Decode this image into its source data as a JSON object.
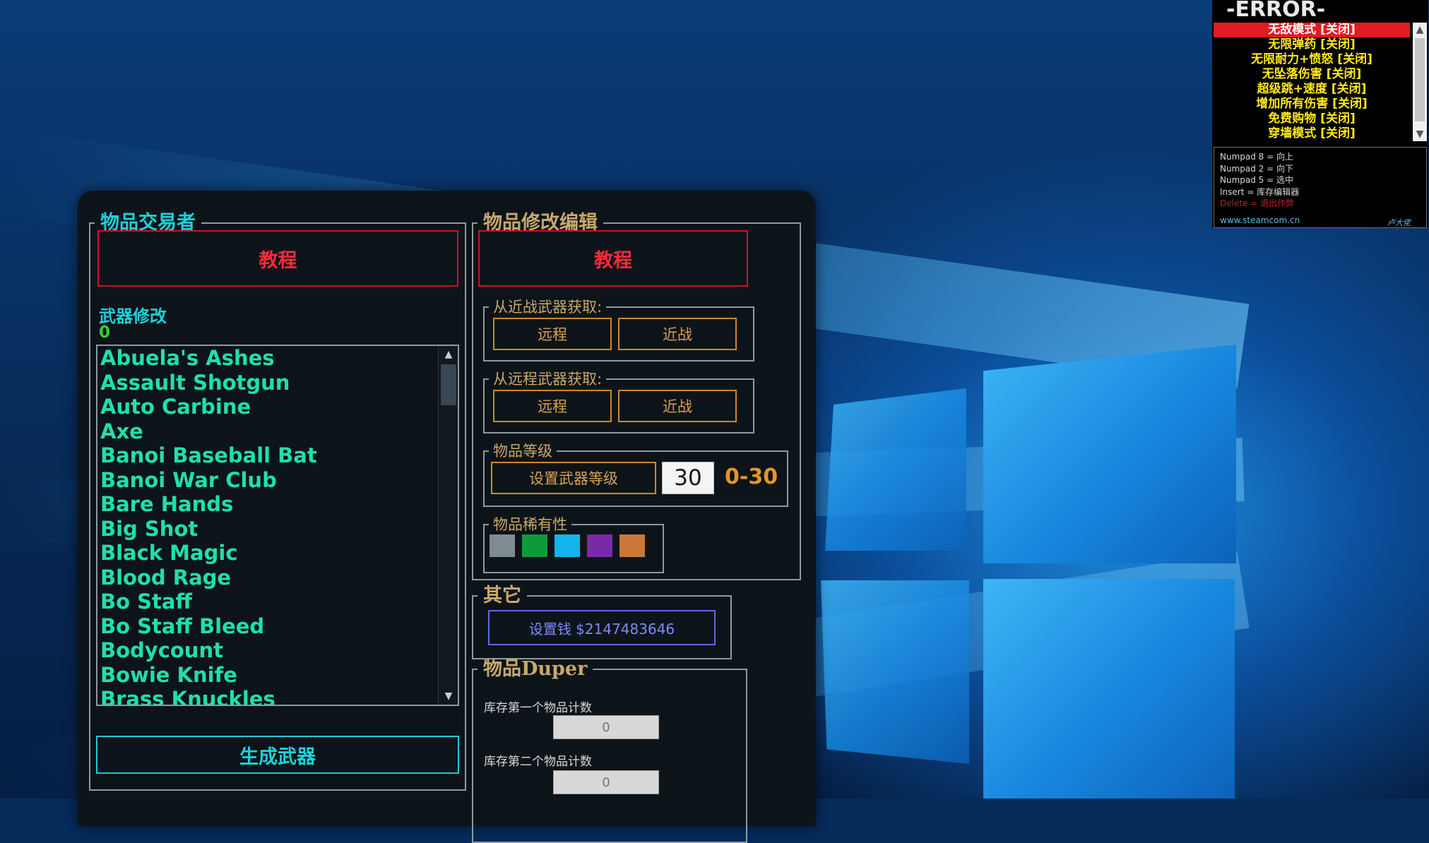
{
  "trader": {
    "title": "物品交易者",
    "tutorial_label": "教程",
    "weapons_label": "武器修改",
    "count": "0",
    "weapons": [
      "Abuela's Ashes",
      "Assault Shotgun",
      "Auto Carbine",
      "Axe",
      "Banoi Baseball Bat",
      "Banoi War Club",
      "Bare Hands",
      "Big Shot",
      "Black Magic",
      "Blood Rage",
      "Bo Staff",
      "Bo Staff Bleed",
      "Bodycount",
      "Bowie Knife",
      "Brass Knuckles"
    ],
    "generate_label": "生成武器"
  },
  "editor": {
    "title": "物品修改编辑",
    "tutorial_label": "教程",
    "from_melee": {
      "legend": "从近战武器获取:",
      "ranged_label": "远程",
      "melee_label": "近战"
    },
    "from_ranged": {
      "legend": "从远程武器获取:",
      "ranged_label": "远程",
      "melee_label": "近战"
    },
    "level": {
      "legend": "物品等级",
      "set_label": "设置武器等级",
      "value": "30",
      "range": "0-30"
    },
    "rarity": {
      "legend": "物品稀有性",
      "colors": [
        "#7f8a91",
        "#0f9a3a",
        "#12b6ec",
        "#7a2aa8",
        "#c9783a"
      ]
    }
  },
  "other": {
    "title": "其它",
    "money_label": "设置钱 $2147483646"
  },
  "duper": {
    "title": "物品Duper",
    "first_label": "库存第一个物品计数",
    "first_value": "0",
    "second_label": "库存第二个物品计数",
    "second_value": "0"
  },
  "overlay": {
    "title": "-ERROR-",
    "cheats": [
      "无敌模式 [关闭]",
      "无限弹药 [关闭]",
      "无限耐力+愤怒 [关闭]",
      "无坠落伤害 [关闭]",
      "超级跳+速度 [关闭]",
      "增加所有伤害 [关闭]",
      "免费购物 [关闭]",
      "穿墙模式 [关闭]"
    ],
    "keys": [
      "Numpad 8 = 向上",
      "Numpad 2 = 向下",
      "Numpad 5 = 选中",
      "Insert = 库存编辑器",
      "Delete = 退出作弊"
    ],
    "site": "www.steamcom.cn",
    "signature": "卢大佬"
  }
}
